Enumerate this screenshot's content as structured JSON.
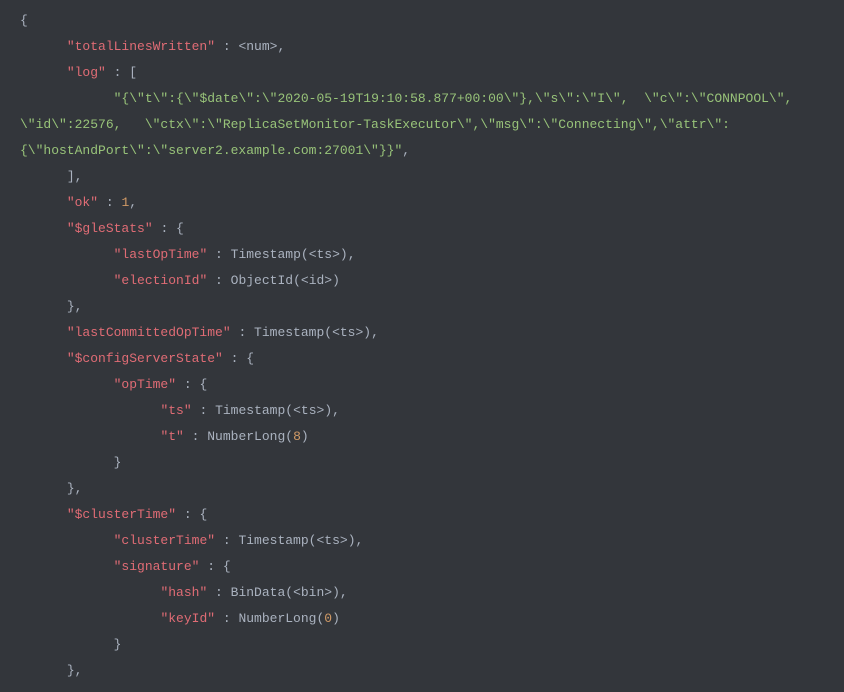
{
  "tokens": {
    "brace_open": "{",
    "brace_close": "}",
    "bracket_open": "[",
    "bracket_close": "]",
    "colon": " : ",
    "comma": ",",
    "paren_open": "(",
    "paren_close": ")",
    "k_totalLinesWritten": "\"totalLinesWritten\"",
    "k_log": "\"log\"",
    "k_ok": "\"ok\"",
    "k_gleStats": "\"$gleStats\"",
    "k_lastOpTime": "\"lastOpTime\"",
    "k_electionId": "\"electionId\"",
    "k_lastCommittedOpTime": "\"lastCommittedOpTime\"",
    "k_configServerState": "\"$configServerState\"",
    "k_opTime": "\"opTime\"",
    "k_ts": "\"ts\"",
    "k_t": "\"t\"",
    "k_clusterTime_outer": "\"$clusterTime\"",
    "k_clusterTime_inner": "\"clusterTime\"",
    "k_signature": "\"signature\"",
    "k_hash": "\"hash\"",
    "k_keyId": "\"keyId\"",
    "v_num_placeholder": "<num>",
    "v_log_line": "\"{\\\"t\\\":{\\\"$date\\\":\\\"2020-05-19T19:10:58.877+00:00\\\"},\\\"s\\\":\\\"I\\\",  \\\"c\\\":\\\"CONNPOOL\\\", \\\"id\\\":22576,   \\\"ctx\\\":\\\"ReplicaSetMonitor-TaskExecutor\\\",\\\"msg\\\":\\\"Connecting\\\",\\\"attr\\\":{\\\"hostAndPort\\\":\\\"server2.example.com:27001\\\"}}\"",
    "v_one": "1",
    "v_eight": "8",
    "v_zero": "0",
    "f_timestamp": "Timestamp",
    "f_objectid": "ObjectId",
    "f_numberlong": "NumberLong",
    "f_bindata": "BinData",
    "ts_placeholder": "<ts>",
    "id_placeholder": "<id>",
    "bin_placeholder": "<bin>"
  }
}
